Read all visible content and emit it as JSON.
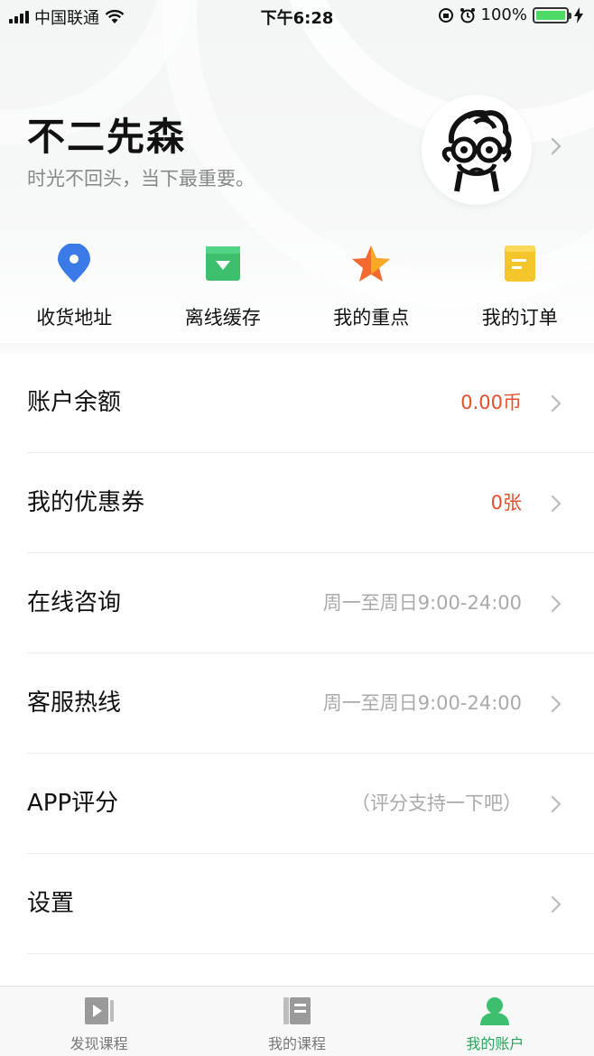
{
  "status_bar": {
    "carrier": "中国联通",
    "time": "下午6:28",
    "battery": "100%"
  },
  "profile": {
    "name": "不二先森",
    "bio": "时光不回头，当下最重要。"
  },
  "shortcuts": [
    {
      "label": "收货地址",
      "icon": "location-pin-icon",
      "color": "#3b7be8"
    },
    {
      "label": "离线缓存",
      "icon": "download-icon",
      "color": "#3cc06e"
    },
    {
      "label": "我的重点",
      "icon": "star-icon",
      "color": "#f26a30"
    },
    {
      "label": "我的订单",
      "icon": "order-icon",
      "color": "#f5c52c"
    }
  ],
  "menu": [
    {
      "title": "账户余额",
      "value": "0.00币",
      "accent": true
    },
    {
      "title": "我的优惠券",
      "value": "0张",
      "accent": true
    },
    {
      "title": "在线咨询",
      "value": "周一至周日9:00-24:00",
      "accent": false
    },
    {
      "title": "客服热线",
      "value": "周一至周日9:00-24:00",
      "accent": false
    },
    {
      "title": "APP评分",
      "value": "（评分支持一下吧）",
      "accent": false
    },
    {
      "title": "设置",
      "value": "",
      "accent": false
    }
  ],
  "tabbar": {
    "discover": "发现课程",
    "courses": "我的课程",
    "account": "我的账户",
    "active_color": "#27a55a"
  },
  "colors": {
    "accent_red": "#e8502c",
    "text_primary": "#111111",
    "text_secondary": "#aaaaaa"
  }
}
